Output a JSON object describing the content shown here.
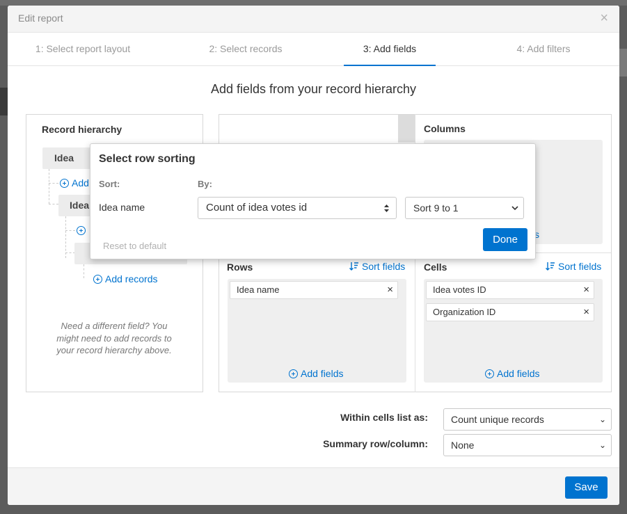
{
  "modal": {
    "title": "Edit report",
    "close_glyph": "×"
  },
  "steps": [
    {
      "label": "1: Select report layout"
    },
    {
      "label": "2: Select records"
    },
    {
      "label": "3: Add fields"
    },
    {
      "label": "4: Add filters"
    }
  ],
  "heading": "Add fields from your record hierarchy",
  "hierarchy": {
    "title": "Record hierarchy",
    "root_node": "Idea",
    "root_add_label": "Add",
    "child_node": "Idea",
    "add_records_label": "Add records",
    "hint": "Need a different field? You might need to add records to your record hierarchy above."
  },
  "columns": {
    "title": "Columns",
    "add_fields_partial": "s"
  },
  "rows": {
    "title": "Rows",
    "sort_label": "Sort fields",
    "chips": [
      "Idea name"
    ],
    "add_fields_label": "Add fields"
  },
  "cells": {
    "title": "Cells",
    "sort_label": "Sort fields",
    "chips": [
      "Idea votes ID",
      "Organization ID"
    ],
    "add_fields_label": "Add fields"
  },
  "options": {
    "within_cells_label": "Within cells list as:",
    "within_cells_value": "Count unique records",
    "summary_label": "Summary row/column:",
    "summary_value": "None"
  },
  "footer": {
    "save_label": "Save"
  },
  "sorting_popover": {
    "title": "Select row sorting",
    "sort_col_label": "Sort:",
    "by_col_label": "By:",
    "field_name": "Idea name",
    "by_value": "Count of idea votes id",
    "order_value": "Sort 9 to 1",
    "reset_label": "Reset to default",
    "done_label": "Done"
  },
  "icons": {
    "chip_remove": "×",
    "select_chevron": "⌄",
    "updown": "⬍"
  },
  "colors": {
    "accent": "#0073cf"
  }
}
